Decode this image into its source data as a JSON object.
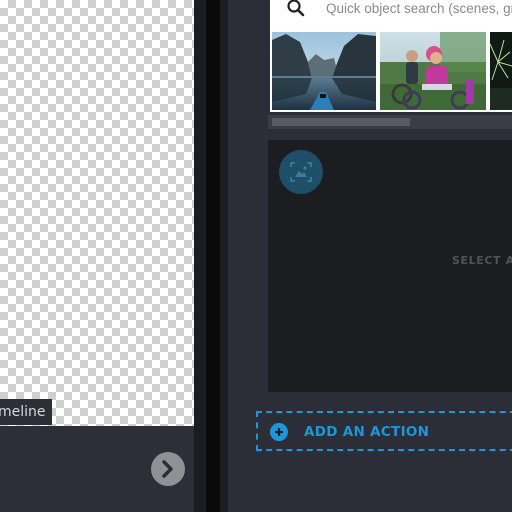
{
  "canvas": {
    "tab_label": "Timeline"
  },
  "media": {
    "search": {
      "placeholder": "Quick object search (scenes, gr"
    },
    "thumbnails": [
      {
        "name": "lake-kayak"
      },
      {
        "name": "girl-bicycle"
      },
      {
        "name": "fireworks"
      }
    ]
  },
  "preview": {
    "prompt": "SELECT A T"
  },
  "actions": {
    "add_label": "ADD AN ACTION"
  },
  "colors": {
    "accent": "#1b97db",
    "panel": "#2b2e36",
    "preview_bg": "#1b1d21",
    "icon_circle": "#1f4f68"
  },
  "icons": [
    "search-icon",
    "image-placeholder-icon",
    "add-circle-icon",
    "chevron-right-icon"
  ]
}
